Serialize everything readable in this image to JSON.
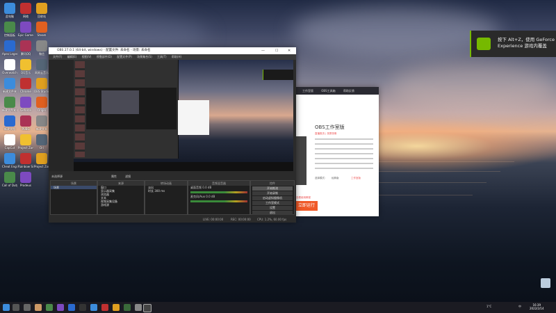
{
  "desktop_icons": [
    {
      "label": "此电脑"
    },
    {
      "label": "网络"
    },
    {
      "label": "回收站"
    },
    {
      "label": "控制面板"
    },
    {
      "label": "Epic Games"
    },
    {
      "label": "Steam"
    },
    {
      "label": "Apex Legends"
    },
    {
      "label": "腾讯QQ"
    },
    {
      "label": "微信"
    },
    {
      "label": "Overwatch"
    },
    {
      "label": "QQ音乐"
    },
    {
      "label": "网易云音乐"
    },
    {
      "label": "新建文件夹"
    },
    {
      "label": "Chrome"
    },
    {
      "label": "OBS Studio"
    },
    {
      "label": "新建文件夹 (2)"
    },
    {
      "label": "Geforce"
    },
    {
      "label": "Origin"
    },
    {
      "label": "新建文档"
    },
    {
      "label": "PUBG"
    },
    {
      "label": "新建文本"
    },
    {
      "label": "CapCut"
    },
    {
      "label": "Project Zomboid"
    },
    {
      "label": "Ori"
    },
    {
      "label": "Cheat Engine"
    },
    {
      "label": "Rainbow Six"
    },
    {
      "label": "Project Zomboid"
    },
    {
      "label": "Call of Duty Modern..."
    },
    {
      "label": "Prodeus"
    }
  ],
  "nvidia_toast": {
    "text_line1": "按下 Alt+Z，使用 GeForce",
    "text_line2": "Experience 游戏内覆盖"
  },
  "obs_window": {
    "title": "OBS 27.0.1 (64-bit, windows) - 配置文件: 未命名 - 场景: 未命名",
    "menu": [
      "文件(F)",
      "编辑(E)",
      "视图(V)",
      "停靠部件(D)",
      "配置文件(P)",
      "场景集合(S)",
      "工具(T)",
      "帮助(H)"
    ],
    "source_header": "未选择源",
    "prop_label": "属性",
    "filter_label": "滤镜",
    "docks": {
      "scenes": {
        "header": "场景",
        "items": [
          "场景"
        ]
      },
      "sources": {
        "header": "来源",
        "items": [
          "窗口",
          "显示器采集",
          "浏览器",
          "文本",
          "视频采集设备",
          "游戏源"
        ]
      },
      "transitions": {
        "header": "转场动画",
        "items": [
          "淡出",
          "时长"
        ],
        "duration": "300 ms"
      },
      "mixer": {
        "header": "音频混音器",
        "items": [
          {
            "name": "桌面音频",
            "level": "0.0 dB"
          },
          {
            "name": "麦克风/Aux",
            "level": "0.0 dB"
          }
        ]
      },
      "controls": {
        "header": "控件",
        "buttons": [
          "开始推流",
          "开始录制",
          "启动虚拟摄像机",
          "工作室模式",
          "设置",
          "退出"
        ]
      }
    },
    "status": {
      "live": "LIVE: 00:00:00",
      "rec": "REC: 00:00:00",
      "cpu": "CPU: 1.2%, 60.00 fps"
    }
  },
  "obs_studio_app": {
    "tabs": [
      "工作室版",
      "OBS工具箱",
      "帮助反馈"
    ],
    "title": "OBS工作室版",
    "subtitle": "直播推流 | 录屏录像",
    "mode_label": "选择模式：",
    "options": [
      "经典版",
      "工作室版"
    ],
    "link": "查看使用教程",
    "start_button": "立即运行"
  },
  "taskbar": {
    "clock_time": "16:39",
    "clock_date": "2022/2/14",
    "weather": "1°C",
    "lang": "中"
  },
  "colors": {
    "nvidia_green": "#76b900",
    "accent_orange": "#f05a28"
  }
}
